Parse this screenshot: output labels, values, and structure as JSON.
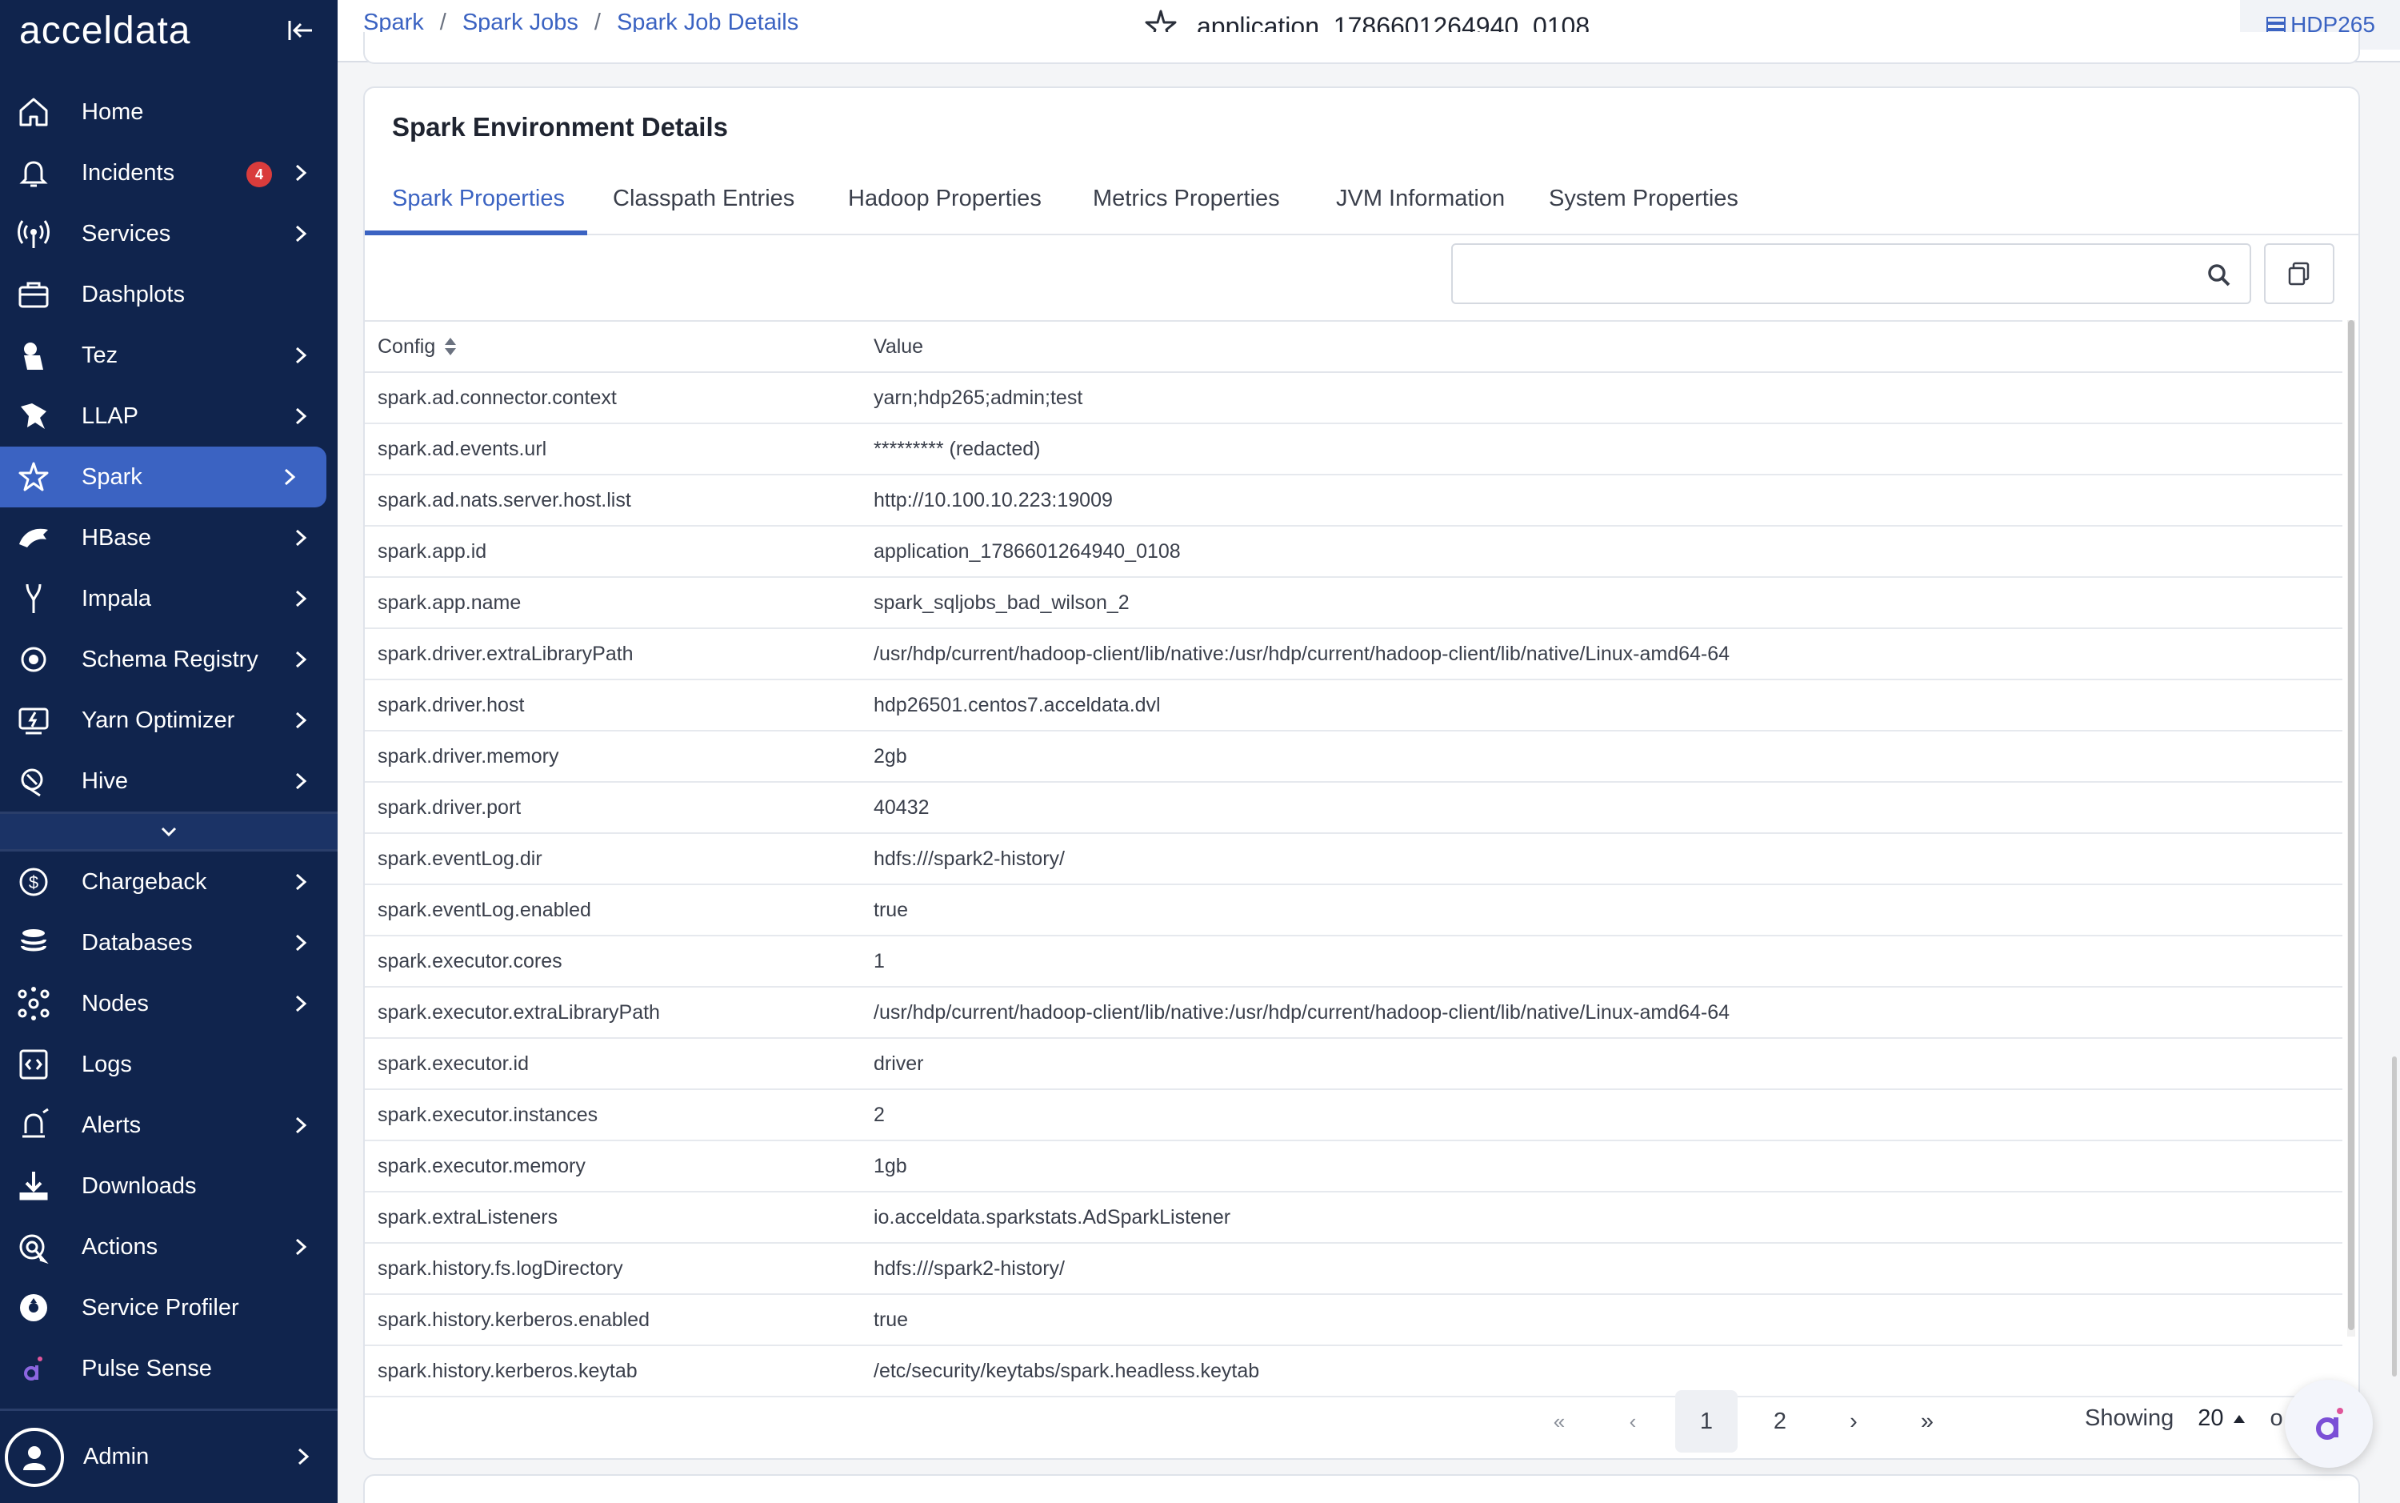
{
  "brand": {
    "logo": "acceldata"
  },
  "sidebar": {
    "items": [
      {
        "label": "Home",
        "icon": "home-icon",
        "chevron": false
      },
      {
        "label": "Incidents",
        "icon": "bell-icon",
        "chevron": true,
        "badge": "4"
      },
      {
        "label": "Services",
        "icon": "broadcast-icon",
        "chevron": true
      },
      {
        "label": "Dashplots",
        "icon": "briefcase-icon",
        "chevron": false
      },
      {
        "label": "Tez",
        "icon": "tez-icon",
        "chevron": true
      },
      {
        "label": "LLAP",
        "icon": "llap-icon",
        "chevron": true
      },
      {
        "label": "Spark",
        "icon": "spark-icon",
        "chevron": true,
        "active": true
      },
      {
        "label": "HBase",
        "icon": "hbase-icon",
        "chevron": true
      },
      {
        "label": "Impala",
        "icon": "impala-icon",
        "chevron": true
      },
      {
        "label": "Schema Registry",
        "icon": "schema-icon",
        "chevron": true
      },
      {
        "label": "Yarn Optimizer",
        "icon": "yarn-icon",
        "chevron": true
      },
      {
        "label": "Hive",
        "icon": "hive-icon",
        "chevron": true
      }
    ],
    "items2": [
      {
        "label": "Chargeback",
        "icon": "dollar-icon",
        "chevron": true
      },
      {
        "label": "Databases",
        "icon": "database-icon",
        "chevron": true
      },
      {
        "label": "Nodes",
        "icon": "nodes-icon",
        "chevron": true
      },
      {
        "label": "Logs",
        "icon": "logs-icon",
        "chevron": false
      },
      {
        "label": "Alerts",
        "icon": "alert-icon",
        "chevron": true
      },
      {
        "label": "Downloads",
        "icon": "download-icon",
        "chevron": false
      },
      {
        "label": "Actions",
        "icon": "actions-icon",
        "chevron": true
      },
      {
        "label": "Service Profiler",
        "icon": "profiler-icon",
        "chevron": false
      },
      {
        "label": "Pulse Sense",
        "icon": "pulse-icon",
        "chevron": false
      }
    ],
    "admin": "Admin"
  },
  "breadcrumb": [
    "Spark",
    "Spark Jobs",
    "Spark Job Details"
  ],
  "app_title": "application_1786601264940_0108",
  "cluster": "HDP265",
  "card": {
    "title": "Spark Environment Details",
    "tabs": [
      "Spark Properties",
      "Classpath Entries",
      "Hadoop Properties",
      "Metrics Properties",
      "JVM Information",
      "System Properties"
    ],
    "search_placeholder": ""
  },
  "table": {
    "headers": {
      "config": "Config",
      "value": "Value"
    },
    "rows": [
      [
        "spark.ad.connector.context",
        "yarn;hdp265;admin;test"
      ],
      [
        "spark.ad.events.url",
        "********* (redacted)"
      ],
      [
        "spark.ad.nats.server.host.list",
        "http://10.100.10.223:19009"
      ],
      [
        "spark.app.id",
        "application_1786601264940_0108"
      ],
      [
        "spark.app.name",
        "spark_sqljobs_bad_wilson_2"
      ],
      [
        "spark.driver.extraLibraryPath",
        "/usr/hdp/current/hadoop-client/lib/native:/usr/hdp/current/hadoop-client/lib/native/Linux-amd64-64"
      ],
      [
        "spark.driver.host",
        "hdp26501.centos7.acceldata.dvl"
      ],
      [
        "spark.driver.memory",
        "2gb"
      ],
      [
        "spark.driver.port",
        "40432"
      ],
      [
        "spark.eventLog.dir",
        "hdfs:///spark2-history/"
      ],
      [
        "spark.eventLog.enabled",
        "true"
      ],
      [
        "spark.executor.cores",
        "1"
      ],
      [
        "spark.executor.extraLibraryPath",
        "/usr/hdp/current/hadoop-client/lib/native:/usr/hdp/current/hadoop-client/lib/native/Linux-amd64-64"
      ],
      [
        "spark.executor.id",
        "driver"
      ],
      [
        "spark.executor.instances",
        "2"
      ],
      [
        "spark.executor.memory",
        "1gb"
      ],
      [
        "spark.extraListeners",
        "io.acceldata.sparkstats.AdSparkListener"
      ],
      [
        "spark.history.fs.logDirectory",
        "hdfs:///spark2-history/"
      ],
      [
        "spark.history.kerberos.enabled",
        "true"
      ],
      [
        "spark.history.kerberos.keytab",
        "/etc/security/keytabs/spark.headless.keytab"
      ]
    ]
  },
  "pagination": {
    "first": "«",
    "prev": "‹",
    "pages": [
      "1",
      "2"
    ],
    "current": "1",
    "next": "›",
    "last": "»",
    "showing_label": "Showing",
    "page_size": "20",
    "trailing": "o"
  },
  "colors": {
    "sidebar": "#10244d",
    "accent": "#3b63c2",
    "badge": "#d93c3c"
  }
}
